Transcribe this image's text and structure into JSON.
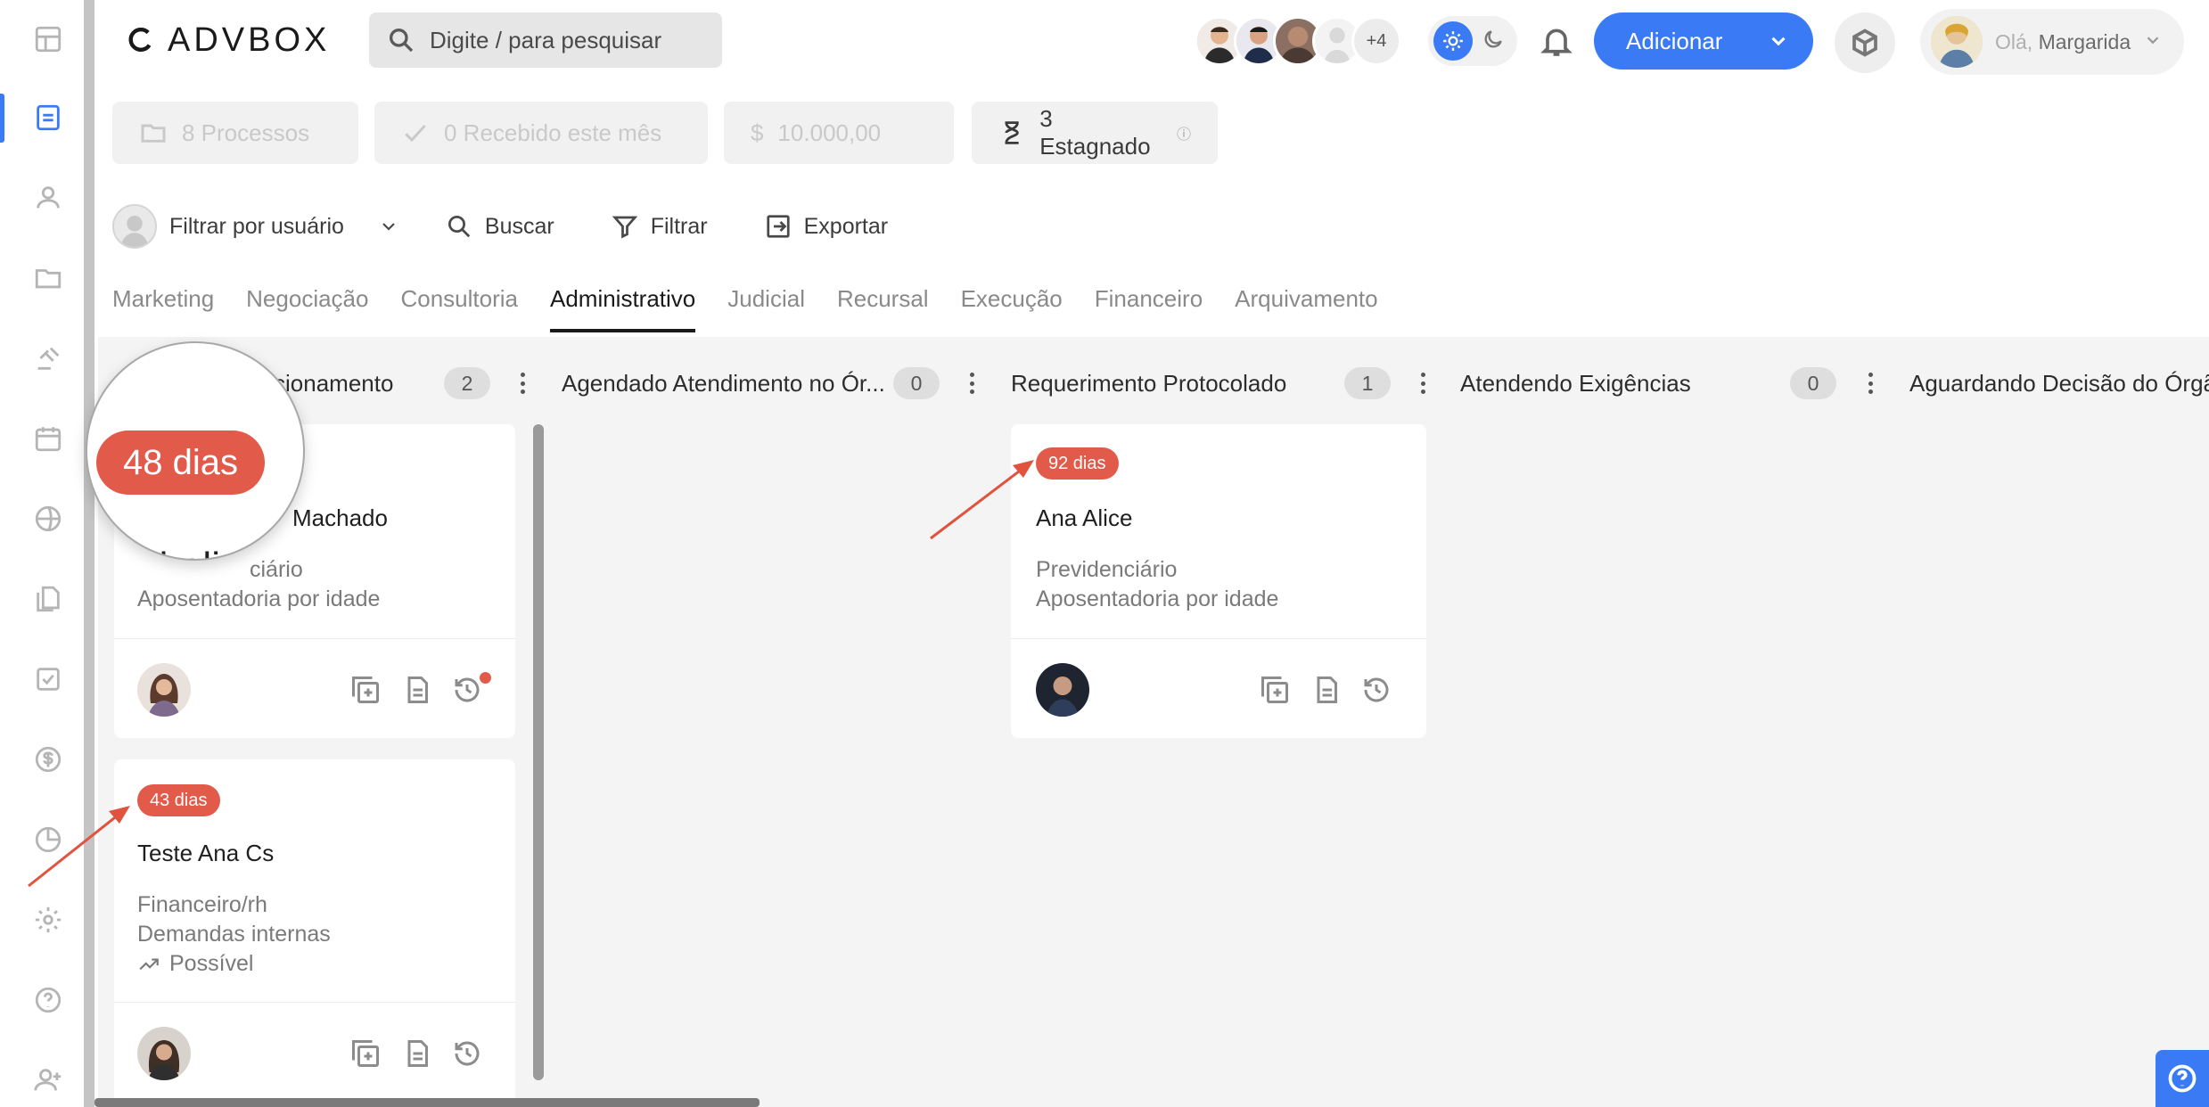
{
  "app": {
    "logo_text": "ADVBOX"
  },
  "search": {
    "placeholder": "Digite / para pesquisar"
  },
  "header": {
    "extra_users": "+4",
    "add_label": "Adicionar",
    "greeting": "Olá,",
    "user_name": "Margarida"
  },
  "stats": [
    {
      "label": "8 Processos",
      "icon": "folder-icon"
    },
    {
      "label": "0 Recebido este mês",
      "icon": "check-icon"
    },
    {
      "label": "10.000,00",
      "prefix": "$",
      "icon": "dollar-icon"
    },
    {
      "label": "3 Estagnado",
      "icon": "hourglass-icon"
    }
  ],
  "toolbar": {
    "user_filter": "Filtrar por usuário",
    "search": "Buscar",
    "filter": "Filtrar",
    "export": "Exportar"
  },
  "tabs": [
    "Marketing",
    "Negociação",
    "Consultoria",
    "Administrativo",
    "Judicial",
    "Recursal",
    "Execução",
    "Financeiro",
    "Arquivamento"
  ],
  "active_tab": "Administrativo",
  "columns": [
    {
      "title": "ticionamento",
      "count": "2"
    },
    {
      "title": "Agendado Atendimento no Ór...",
      "count": "0"
    },
    {
      "title": "Requerimento Protocolado",
      "count": "1"
    },
    {
      "title": "Atendendo Exigências",
      "count": "0"
    },
    {
      "title": "Aguardando Decisão do Órgã",
      "count": ""
    }
  ],
  "cards": [
    {
      "name": "Machado",
      "line1": "ciário",
      "line2": "Aposentadoria por idade"
    },
    {
      "badge": "43 dias",
      "name": "Teste Ana Cs",
      "line1": "Financeiro/rh",
      "line2": "Demandas internas",
      "line3": "Possível"
    },
    {
      "badge": "92 dias",
      "name": "Ana Alice",
      "line1": "Previdenciário",
      "line2": "Aposentadoria por idade"
    }
  ],
  "magnifier": {
    "badge": "48 dias",
    "name_fragment": "lathali"
  },
  "colors": {
    "accent": "#3a7bf5",
    "badge": "#e25a4a",
    "board_bg": "#f4f4f4"
  }
}
